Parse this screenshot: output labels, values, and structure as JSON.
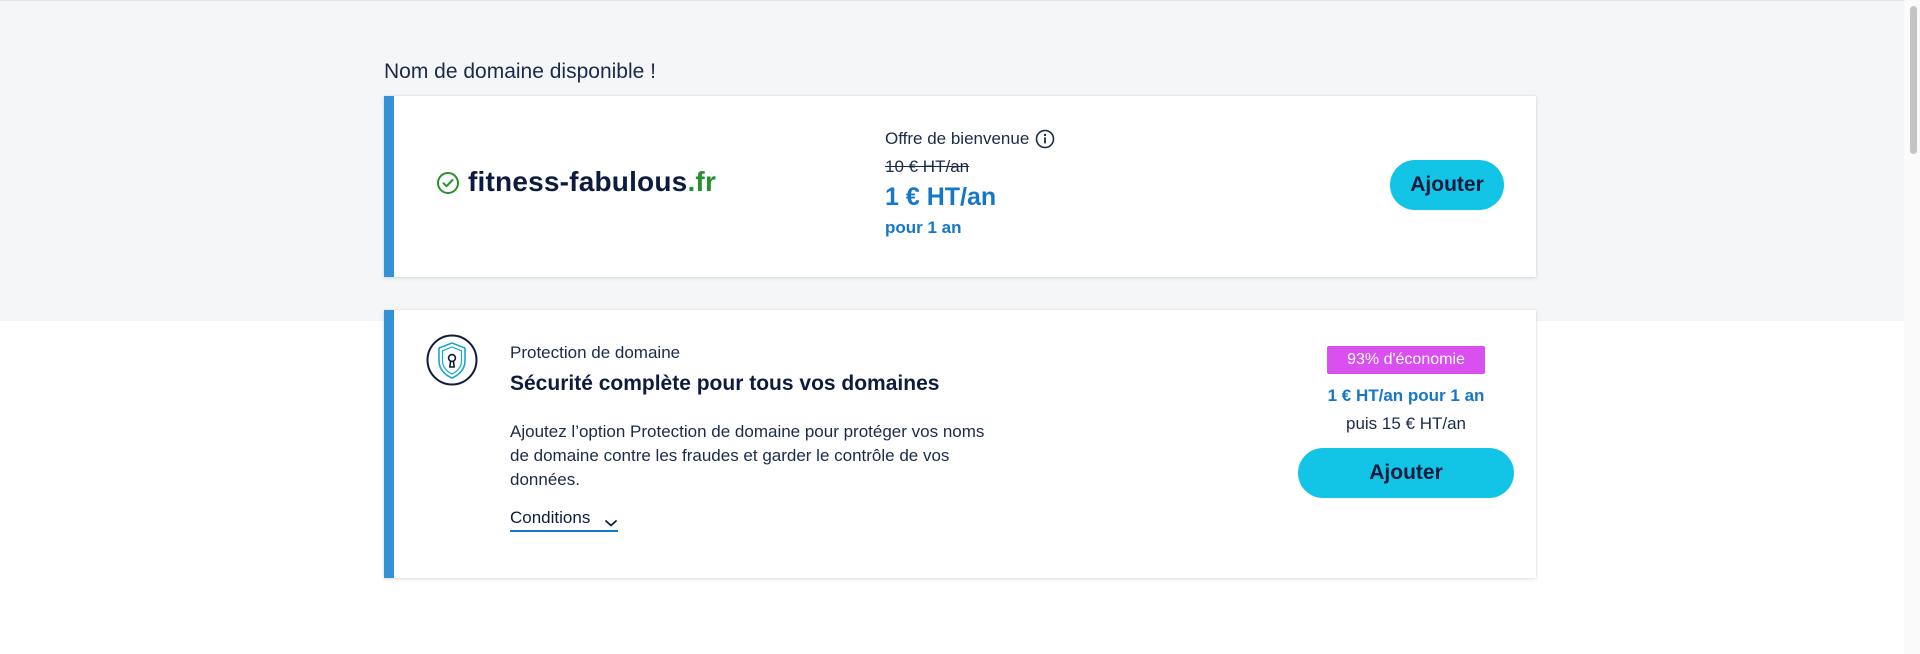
{
  "section": {
    "title": "Nom de domaine disponible !"
  },
  "domain_card": {
    "name": "fitness-fabulous",
    "tld": ".fr",
    "offer_title": "Offre de bienvenue",
    "old_price": "10 € HT/an",
    "new_price": "1 € HT/an",
    "duration": "pour 1 an",
    "add_label": "Ajouter"
  },
  "protection_card": {
    "kicker": "Protection de domaine",
    "title": "Sécurité complète pour tous vos domaines",
    "description": "Ajoutez l’option Protection de domaine pour protéger vos noms de domaine contre les fraudes et garder le contrôle de vos données.",
    "conditions_label": "Conditions",
    "badge": "93% d'économie",
    "promo_price": "1 € HT/an pour 1 an",
    "then_price": "puis 15 € HT/an",
    "add_label": "Ajouter"
  },
  "colors": {
    "accent_blue": "#3391d7",
    "price_blue": "#1477c9",
    "button_cyan": "#12c4e6",
    "badge_magenta": "#d94ff0",
    "tld_green": "#2a8f2f"
  },
  "icons": {
    "check": "check-circle-icon",
    "info": "info-icon",
    "shield": "shield-lock-icon",
    "chevron": "chevron-down-icon"
  }
}
